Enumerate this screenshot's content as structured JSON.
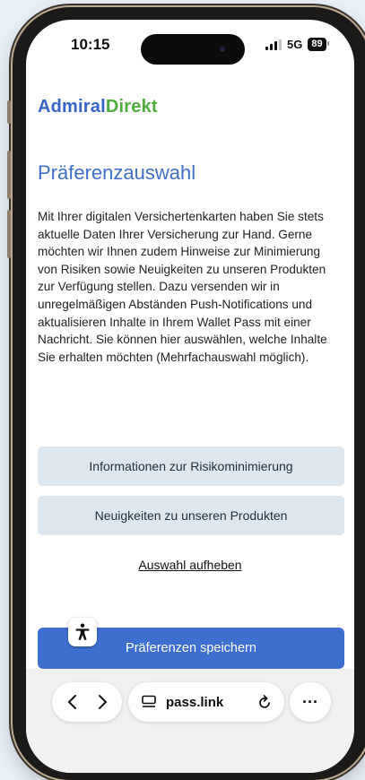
{
  "status_bar": {
    "time": "10:15",
    "network": "5G",
    "battery": "89"
  },
  "brand": {
    "part1": "Admiral",
    "part2": "Direkt",
    "color1": "#3465c7",
    "color2": "#4fae3e"
  },
  "page": {
    "title": "Präferenzauswahl",
    "description": "Mit Ihrer digitalen Versichertenkarten haben Sie stets aktuelle Daten Ihrer Versicherung zur Hand. Gerne möchten wir Ihnen zudem Hinweise zur Minimierung von Risiken sowie Neuigkeiten zu unseren Produkten zur Verfügung stellen. Dazu versenden wir in unregelmäßigen Abständen Push-Notifications und aktualisieren Inhalte in Ihrem Wallet Pass mit einer Nachricht. Sie können hier auswählen, welche Inhalte Sie erhalten möchten (Mehrfachauswahl möglich).",
    "options": [
      "Informationen zur Risikominimierung",
      "Neuigkeiten zu unseren Produkten"
    ],
    "reset_label": "Auswahl aufheben",
    "save_label": "Präferenzen speichern"
  },
  "browser": {
    "url": "pass.link",
    "more": "···"
  },
  "icons": {
    "back": "chevron-left-icon",
    "forward": "chevron-right-icon",
    "tabs": "tab-icon",
    "reload": "reload-icon",
    "accessibility": "accessibility-icon"
  }
}
